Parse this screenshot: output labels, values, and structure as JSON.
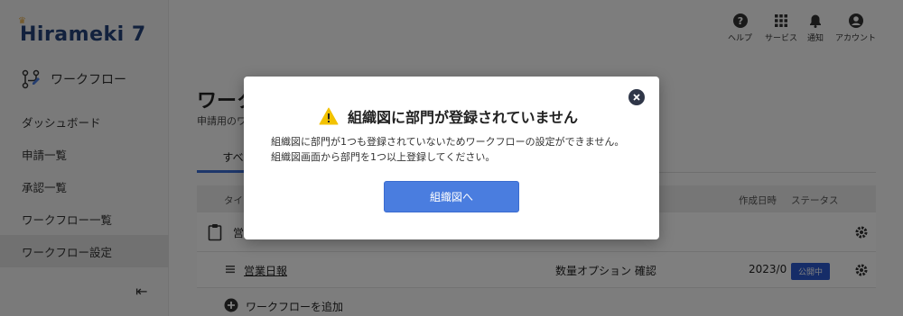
{
  "app": {
    "logo": "Hirameki 7",
    "section": "ワークフロー",
    "nav": [
      "ダッシュボード",
      "申請一覧",
      "承認一覧",
      "ワークフロー一覧",
      "ワークフロー設定"
    ],
    "active_nav_index": 4
  },
  "topbar": {
    "help": "ヘルプ",
    "services": "サービス",
    "notifications": "通知",
    "account": "アカウント"
  },
  "main": {
    "title": "ワーク",
    "subtitle": "申請用のワ",
    "tab_active": "すべ",
    "table": {
      "headers": [
        "タイ",
        "作成日時",
        "ステータス"
      ],
      "group_label": "営",
      "row": {
        "name": "営業日報",
        "category": "数量オプション 確認",
        "created": "2023/0",
        "status": "公開中"
      }
    },
    "add_workflow": "ワークフローを追加"
  },
  "modal": {
    "title": "組織図に部門が登録されていません",
    "message_line1": "組織図に部門が1つも登録されていないためワークフローの設定ができません。",
    "message_line2": "組織図画面から部門を1つ以上登録してください。",
    "button": "組織図へ"
  },
  "colors": {
    "primary": "#4a7ddf",
    "logo": "#24427a",
    "warning": "#f2c200",
    "badge": "#2d5bd1"
  }
}
